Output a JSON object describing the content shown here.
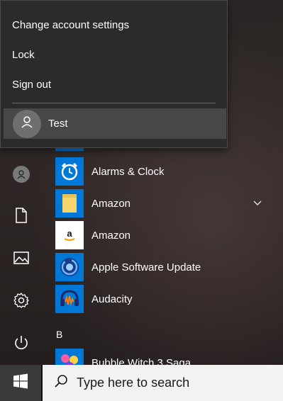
{
  "account_flyout": {
    "items": [
      {
        "label": "Change account settings"
      },
      {
        "label": "Lock"
      },
      {
        "label": "Sign out"
      }
    ],
    "user": {
      "name": "Test"
    }
  },
  "apps": [
    {
      "label": "Alarms & Clock",
      "icon": "alarm-clock-icon",
      "color": "#0078d7"
    },
    {
      "label": "Amazon",
      "icon": "folder-icon",
      "color": "#0078d7",
      "expandable": true
    },
    {
      "label": "Amazon",
      "icon": "amazon-icon",
      "color": "#ffffff"
    },
    {
      "label": "Apple Software Update",
      "icon": "apple-update-icon",
      "color": "#0078d7"
    },
    {
      "label": "Audacity",
      "icon": "audacity-icon",
      "color": "#0078d7"
    }
  ],
  "section_letter": "B",
  "partial_app": {
    "label": "Bubble Witch 3 Saga",
    "icon": "bubble-witch-icon",
    "color": "#0078d7"
  },
  "rail": [
    "user-icon",
    "document-icon",
    "pictures-icon",
    "settings-icon",
    "power-icon"
  ],
  "taskbar": {
    "search_placeholder": "Type here to search"
  },
  "colors": {
    "accent": "#0078d7",
    "flyout_bg": "#2b2b2b",
    "taskbar": "#101010"
  }
}
